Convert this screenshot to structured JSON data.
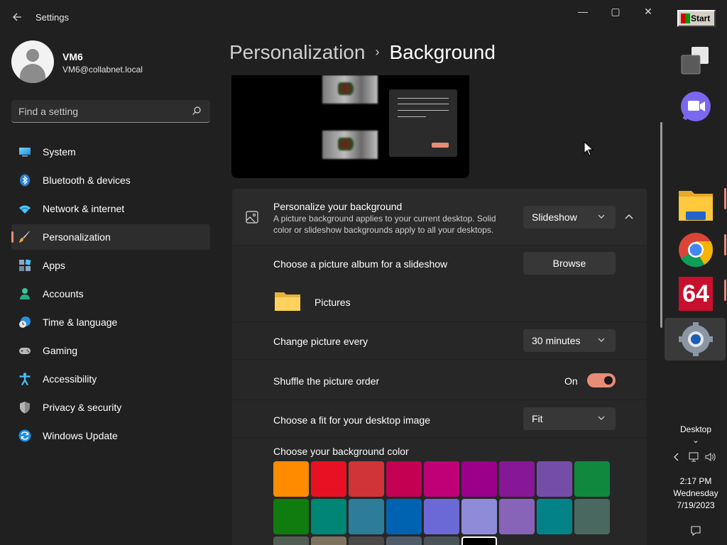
{
  "window": {
    "title": "Settings",
    "controls": {
      "minimize": "—",
      "maximize": "▢",
      "close": "✕"
    }
  },
  "user": {
    "name": "VM6",
    "email": "VM6@collabnet.local"
  },
  "search": {
    "placeholder": "Find a setting"
  },
  "nav": [
    {
      "label": "System",
      "icon": "monitor-icon",
      "selected": false
    },
    {
      "label": "Bluetooth & devices",
      "icon": "bluetooth-icon",
      "selected": false
    },
    {
      "label": "Network & internet",
      "icon": "wifi-icon",
      "selected": false
    },
    {
      "label": "Personalization",
      "icon": "brush-icon",
      "selected": true
    },
    {
      "label": "Apps",
      "icon": "apps-icon",
      "selected": false
    },
    {
      "label": "Accounts",
      "icon": "person-icon",
      "selected": false
    },
    {
      "label": "Time & language",
      "icon": "globe-clock-icon",
      "selected": false
    },
    {
      "label": "Gaming",
      "icon": "gamepad-icon",
      "selected": false
    },
    {
      "label": "Accessibility",
      "icon": "accessibility-icon",
      "selected": false
    },
    {
      "label": "Privacy & security",
      "icon": "shield-icon",
      "selected": false
    },
    {
      "label": "Windows Update",
      "icon": "update-icon",
      "selected": false
    }
  ],
  "breadcrumb": {
    "parent": "Personalization",
    "separator": "›",
    "current": "Background"
  },
  "background": {
    "title": "Personalize your background",
    "description": "A picture background applies to your current desktop. Solid color or slideshow backgrounds apply to all your desktops.",
    "type_value": "Slideshow",
    "album_label": "Choose a picture album for a slideshow",
    "browse_label": "Browse",
    "album_name": "Pictures",
    "interval_label": "Change picture every",
    "interval_value": "30 minutes",
    "shuffle_label": "Shuffle the picture order",
    "shuffle_state": "On",
    "fit_label": "Choose a fit for your desktop image",
    "fit_value": "Fit",
    "color_label": "Choose your background color"
  },
  "colors": {
    "accent": "#e98c77",
    "swatches_row1": [
      "#ff8c00",
      "#e81123",
      "#d13438",
      "#c30052",
      "#bf0077",
      "#9a0089",
      "#881798",
      "#744da9",
      "#10893e"
    ],
    "swatches_row2": [
      "#107c10",
      "#018574",
      "#2d7d9a",
      "#0063b1",
      "#6b69d6",
      "#8e8cd8",
      "#8764b8",
      "#038387",
      "#486860"
    ],
    "swatches_row3": [
      "#525e54",
      "#7e735f",
      "#4c4a48",
      "#515c6b",
      "#4a5459",
      "#000000"
    ]
  },
  "taskbar": {
    "start_label": "Start",
    "apps": [
      "task-view-icon",
      "meet-icon",
      "file-explorer-icon",
      "chrome-icon",
      "aida64-icon",
      "settings-icon"
    ],
    "aida_label": "64",
    "desktop_label": "Desktop",
    "time": "2:17 PM",
    "day": "Wednesday",
    "date": "7/19/2023"
  }
}
